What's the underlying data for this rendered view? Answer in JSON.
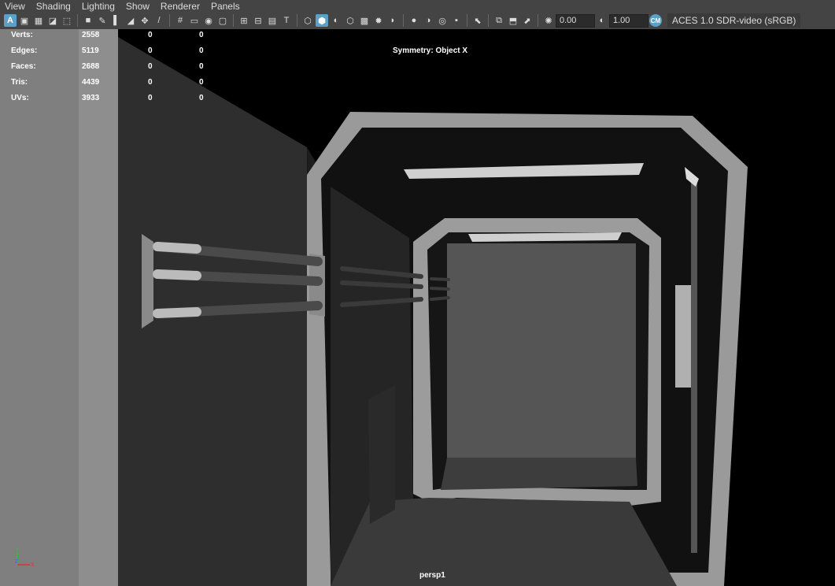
{
  "menu": [
    "View",
    "Shading",
    "Lighting",
    "Show",
    "Renderer",
    "Panels"
  ],
  "toolbar": {
    "icons": [
      "select-camera-icon",
      "camera-attributes-icon",
      "bookmarks-icon",
      "image-plane-icon",
      "2d-pan-icon",
      "grease-pencil-icon",
      "grid-icon",
      "film-gate-icon",
      "resolution-gate-icon",
      "gate-mask-icon",
      "field-chart-icon",
      "safe-action-icon",
      "safe-title-icon",
      "wireframe-icon",
      "smooth-shade-icon",
      "default-material-icon",
      "textured-icon",
      "use-all-lights-icon",
      "shadows-icon",
      "ambient-occlusion-icon",
      "motion-blur-icon",
      "anti-aliasing-icon",
      "depth-of-field-icon",
      "isolate-select-icon",
      "xray-icon",
      "xray-active-components-icon",
      "xray-joints-icon",
      "exposure-icon",
      "gamma-icon",
      "color-management-icon"
    ],
    "exposure_value": "0.00",
    "gamma_value": "1.00",
    "color_space": "ACES 1.0 SDR-video (sRGB)"
  },
  "hud": {
    "rows": [
      {
        "label": "Verts:",
        "v1": "2558",
        "v2": "0",
        "v3": "0"
      },
      {
        "label": "Edges:",
        "v1": "5119",
        "v2": "0",
        "v3": "0"
      },
      {
        "label": "Faces:",
        "v1": "2688",
        "v2": "0",
        "v3": "0"
      },
      {
        "label": "Tris:",
        "v1": "4439",
        "v2": "0",
        "v3": "0"
      },
      {
        "label": "UVs:",
        "v1": "3933",
        "v2": "0",
        "v3": "0"
      }
    ],
    "symmetry": "Symmetry: Object X",
    "camera": "persp1"
  },
  "axis": {
    "y": "Y",
    "z": "Z",
    "x": "X"
  },
  "colors": {
    "accent": "#5aa0c8",
    "axis_x": "#e03030",
    "axis_y": "#30c030",
    "axis_z": "#4060ff"
  }
}
